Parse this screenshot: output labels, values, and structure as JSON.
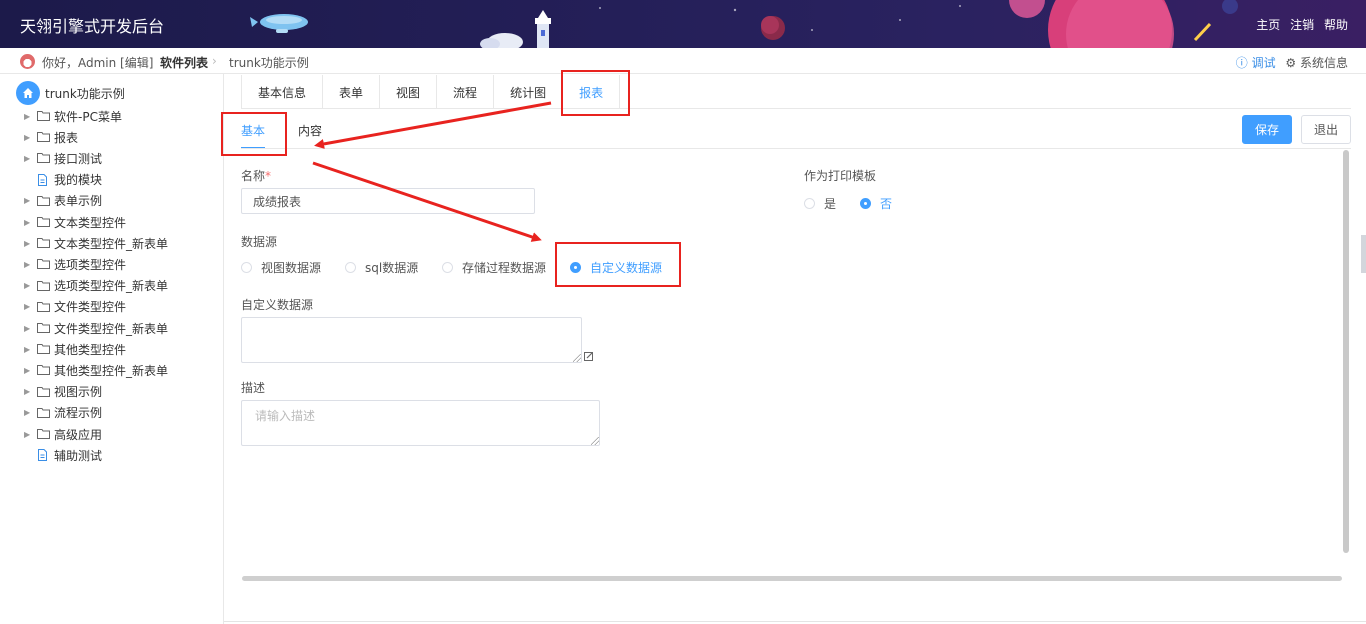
{
  "header": {
    "app_title": "天翎引擎式开发后台",
    "nav": [
      "主页",
      "注销",
      "帮助"
    ]
  },
  "crumbbar": {
    "greeting": "你好，Admin [编辑]",
    "breadcrumb": [
      "软件列表",
      "trunk功能示例"
    ],
    "debug": "ⓘ 调试",
    "system_info": "⚙ 系统信息"
  },
  "sidebar": {
    "root_label": "trunk功能示例",
    "items": [
      {
        "label": "软件-PC菜单",
        "type": "folder"
      },
      {
        "label": "报表",
        "type": "folder"
      },
      {
        "label": "接口测试",
        "type": "folder"
      },
      {
        "label": "我的模块",
        "type": "file"
      },
      {
        "label": "表单示例",
        "type": "folder"
      },
      {
        "label": "文本类型控件",
        "type": "folder"
      },
      {
        "label": "文本类型控件_新表单",
        "type": "folder"
      },
      {
        "label": "选项类型控件",
        "type": "folder"
      },
      {
        "label": "选项类型控件_新表单",
        "type": "folder"
      },
      {
        "label": "文件类型控件",
        "type": "folder"
      },
      {
        "label": "文件类型控件_新表单",
        "type": "folder"
      },
      {
        "label": "其他类型控件",
        "type": "folder"
      },
      {
        "label": "其他类型控件_新表单",
        "type": "folder"
      },
      {
        "label": "视图示例",
        "type": "folder"
      },
      {
        "label": "流程示例",
        "type": "folder"
      },
      {
        "label": "高级应用",
        "type": "folder"
      },
      {
        "label": "辅助测试",
        "type": "file"
      }
    ]
  },
  "tabs": [
    {
      "label": "基本信息",
      "active": false
    },
    {
      "label": "表单",
      "active": false
    },
    {
      "label": "视图",
      "active": false
    },
    {
      "label": "流程",
      "active": false
    },
    {
      "label": "统计图",
      "active": false
    },
    {
      "label": "报表",
      "active": true
    }
  ],
  "subtabs": [
    {
      "label": "基本",
      "active": true
    },
    {
      "label": "内容",
      "active": false
    }
  ],
  "buttons": {
    "save": "保存",
    "quit": "退出"
  },
  "form": {
    "name_label": "名称",
    "name_required": "*",
    "name_value": "成绩报表",
    "print_template_label": "作为打印模板",
    "print_template_options": [
      "是",
      "否"
    ],
    "print_template_selected": "否",
    "datasource_label": "数据源",
    "datasource_options": [
      "视图数据源",
      "sql数据源",
      "存储过程数据源",
      "自定义数据源"
    ],
    "datasource_selected": "自定义数据源",
    "custom_datasource_label": "自定义数据源",
    "custom_datasource_value": "",
    "description_label": "描述",
    "description_placeholder": "请输入描述"
  },
  "colors": {
    "accent": "#409eff",
    "annotation": "#e8231f",
    "header_bg": "#1c1a4a"
  }
}
